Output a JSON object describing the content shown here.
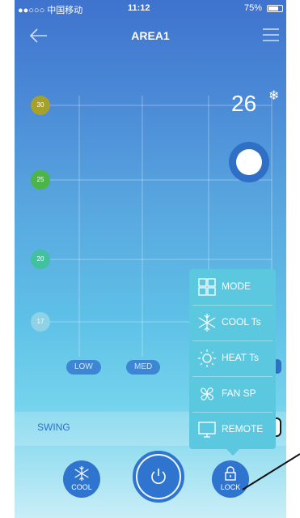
{
  "status_bar": {
    "carrier": "●●○○○ 中国移动",
    "time": "11:12",
    "battery": "75%"
  },
  "header": {
    "title": "AREA1"
  },
  "temperature_scale": {
    "t30": "30",
    "t25": "25",
    "t20": "20",
    "t17": "17"
  },
  "set_temperature": "26",
  "fan_speeds": {
    "low": "LOW",
    "med": "MED"
  },
  "swing": {
    "label": "SWING"
  },
  "popup_menu": {
    "items": [
      "MODE",
      "COOL Ts",
      "HEAT Ts",
      "FAN SP",
      "REMOTE"
    ]
  },
  "bottom_bar": {
    "cool_label": "COOL",
    "lock_label": "LOCK"
  },
  "icons": [
    "wifi-icon",
    "back-arrow-icon",
    "menu-icon",
    "snowflake-icon",
    "grid-icon",
    "sun-icon",
    "fan-icon",
    "monitor-icon",
    "power-icon",
    "lock-icon"
  ],
  "colors": {
    "primary": "#2f75cf",
    "badge30": "#a6a12c",
    "badge25": "#4cb54a",
    "badge20": "#43c0a0",
    "badge17": "#8fd2e6"
  }
}
